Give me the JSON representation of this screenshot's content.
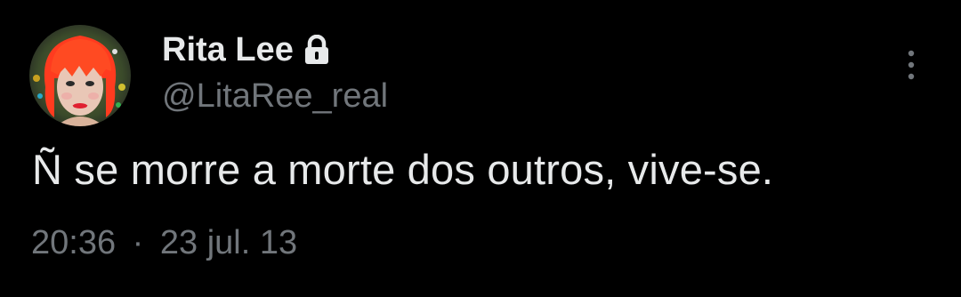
{
  "author": {
    "display_name": "Rita Lee",
    "handle": "@LitaRee_real",
    "protected_icon": "lock-icon",
    "avatar": "profile-avatar"
  },
  "tweet": {
    "text": "Ñ se morre a morte dos outros, vive-se.",
    "time": "20:36",
    "separator": "·",
    "date": "23 jul. 13"
  },
  "actions": {
    "more_icon": "more-vertical-icon"
  },
  "colors": {
    "background": "#000000",
    "primary_text": "#e7e9ea",
    "secondary_text": "#71767b",
    "avatar_hair": "#ff3b1f"
  }
}
